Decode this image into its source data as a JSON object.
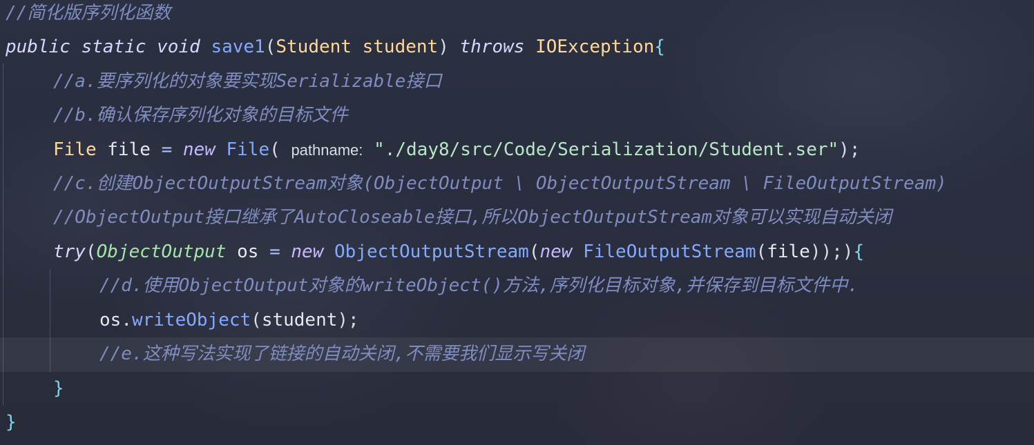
{
  "code": {
    "line1": {
      "comment": "//简化版序列化函数"
    },
    "line2": {
      "mod1": "public",
      "mod2": "static",
      "ret": "void",
      "name": "save1",
      "paren_open": "(",
      "ptype": "Student",
      "pname": "student",
      "paren_close": ")",
      "throws": "throws",
      "exc": "IOException",
      "brace": "{"
    },
    "line3": {
      "comment": "//a.要序列化的对象要实现Serializable接口"
    },
    "line4": {
      "comment": "//b.确认保存序列化对象的目标文件"
    },
    "line5": {
      "type": "File",
      "var": "file",
      "eq": "=",
      "new": "new",
      "ctor": "File",
      "open": "(",
      "hint": "pathname:",
      "str": "\"./day8/src/Code/Serialization/Student.ser\"",
      "close": ");"
    },
    "line6": {
      "comment": "//c.创建ObjectOutputStream对象(ObjectOutput \\ ObjectOutputStream \\ FileOutputStream)"
    },
    "line7": {
      "comment": "//ObjectOutput接口继承了AutoCloseable接口,所以ObjectOutputStream对象可以实现自动关闭"
    },
    "line8": {
      "try": "try",
      "open": "(",
      "type": "ObjectOutput",
      "var": "os",
      "eq": "=",
      "new1": "new",
      "cls1": "ObjectOutputStream",
      "open2": "(",
      "new2": "new",
      "cls2": "FileOutputStream",
      "open3": "(",
      "arg": "file",
      "close": "));",
      "close2": ")",
      "brace": "{"
    },
    "line9": {
      "comment": "//d.使用ObjectOutput对象的writeObject()方法,序列化目标对象,并保存到目标文件中."
    },
    "line10": {
      "obj": "os",
      "dot": ".",
      "method": "writeObject",
      "open": "(",
      "arg": "student",
      "close": ");"
    },
    "line11": {
      "comment": "//e.这种写法实现了链接的自动关闭,不需要我们显示写关闭"
    },
    "line12": {
      "brace": "}"
    },
    "line13": {
      "brace": "}"
    }
  }
}
